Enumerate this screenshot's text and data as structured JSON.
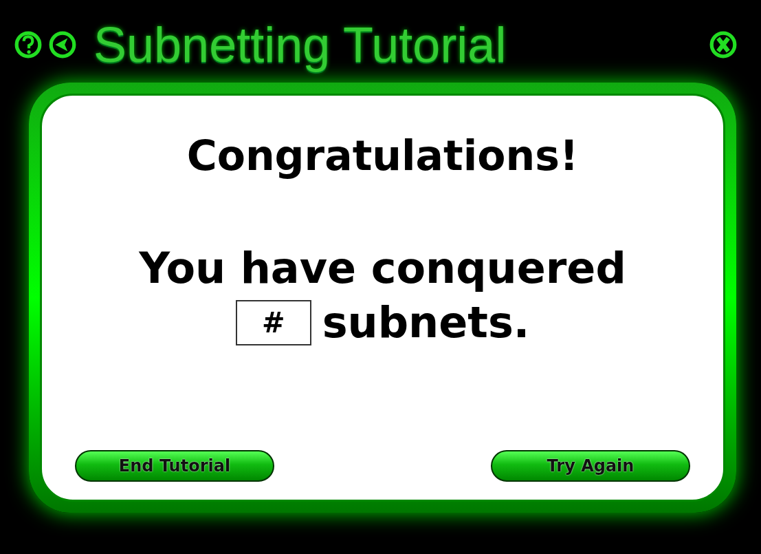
{
  "window": {
    "title": "Subnetting Tutorial"
  },
  "heading": "Congratulations!",
  "message": "You have conquered",
  "result": {
    "value": "#",
    "unit": "subnets."
  },
  "buttons": [
    "End Tutorial",
    "Try Again"
  ]
}
